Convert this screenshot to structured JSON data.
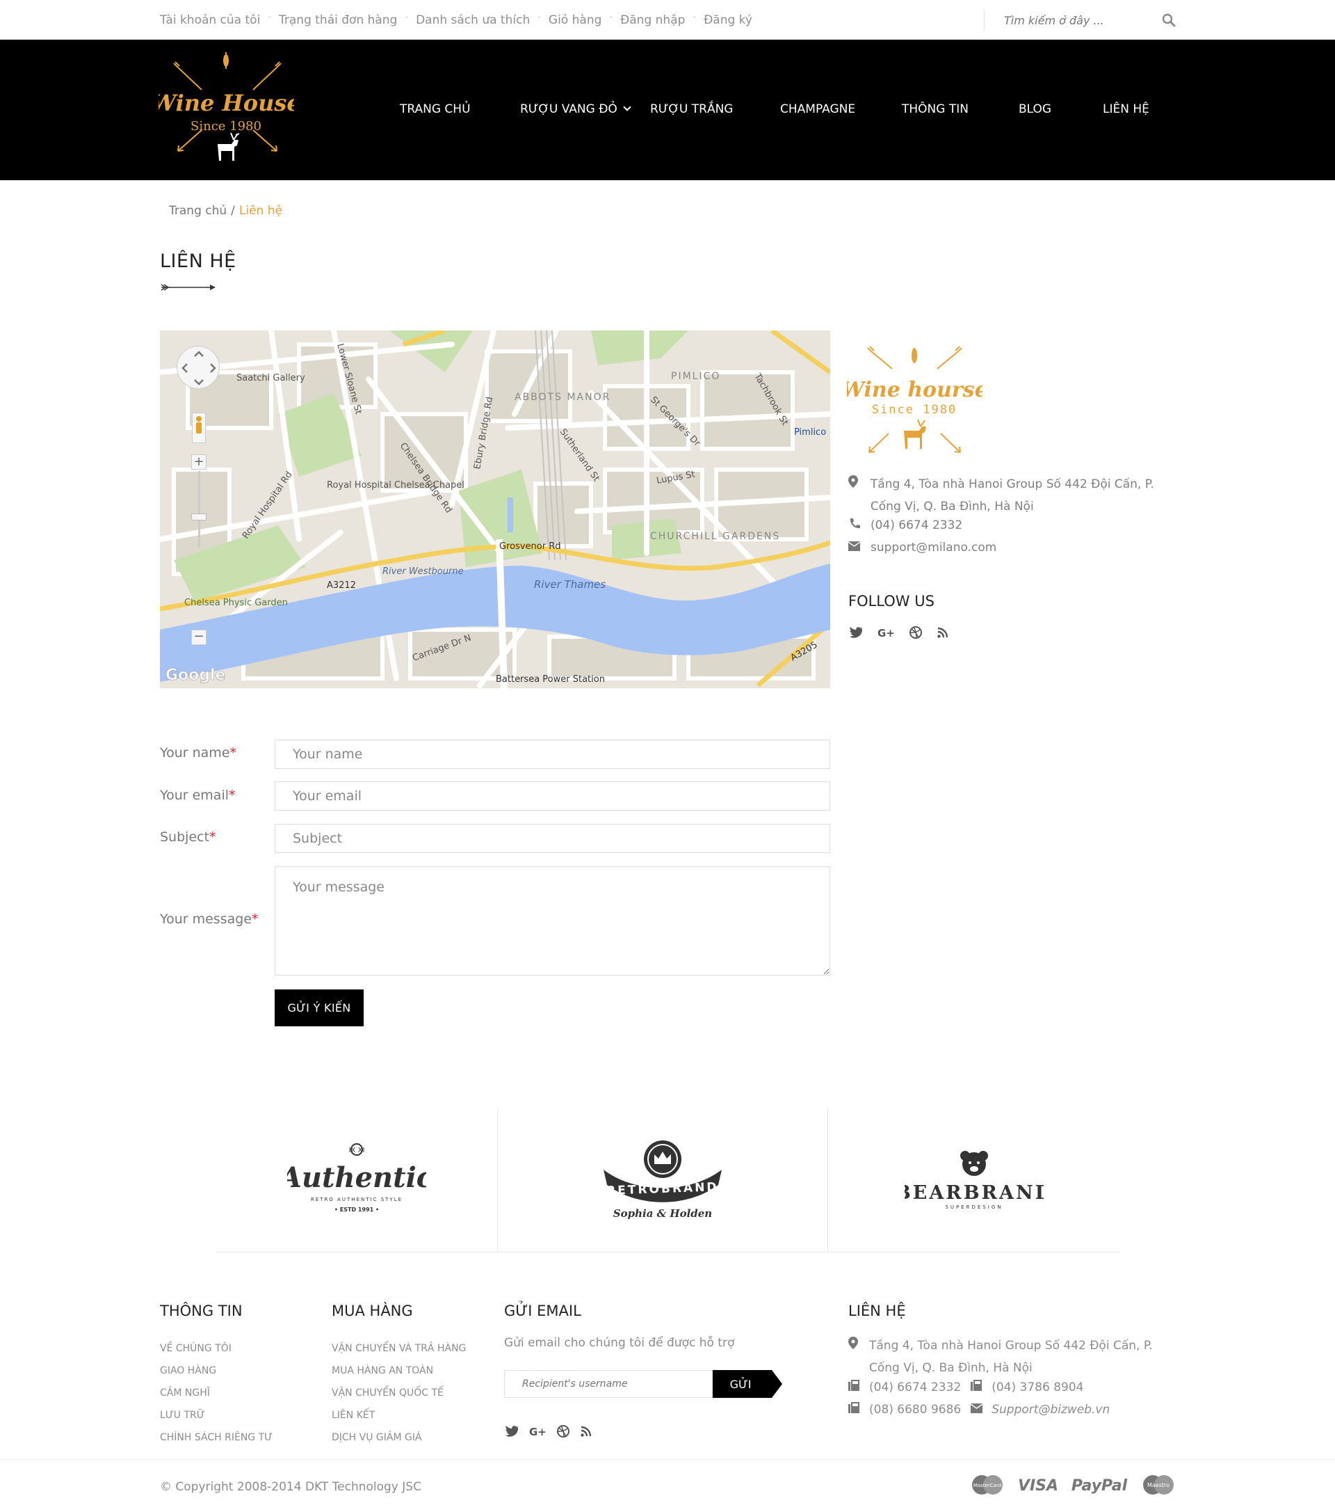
{
  "topbar": {
    "links": [
      "Tài khoản của tôi",
      "Trạng thái đơn hàng",
      "Danh sách ưa thích",
      "Giỏ hàng",
      "Đăng nhập",
      "Đăng ký"
    ],
    "search_placeholder": "Tìm kiếm ở đây ..."
  },
  "logo": {
    "name": "Wine House",
    "since": "Since 1980"
  },
  "nav": [
    "TRANG CHỦ",
    "RƯỢU VANG ĐỎ",
    "RƯỢU TRẮNG",
    "CHAMPAGNE",
    "THÔNG TIN",
    "BLOG",
    "LIÊN HỆ"
  ],
  "breadcrumb": {
    "home": "Trang chủ",
    "current": "Liên hệ"
  },
  "page_title": "LIÊN HỆ",
  "map": {
    "labels": [
      "Saatchi Gallery",
      "Royal Hospital Chelsea Chapel",
      "ABBOTS MANOR",
      "PIMLICO",
      "Pimlico",
      "CHURCHILL GARDENS",
      "Grosvenor Rd",
      "A3212",
      "River Thames",
      "River Westbourne",
      "Chelsea Physic Garden",
      "Battersea Power Station",
      "Chelsea Bridge Rd",
      "Royal Hospital Rd",
      "Sutherland St",
      "Lupus St",
      "Lower Sloane St",
      "Ebury Bridge Rd",
      "St George's Dr",
      "Tachbrook St",
      "A3205",
      "Carriage Dr N",
      "Google"
    ]
  },
  "side_logo": {
    "name": "Wine hourse",
    "since": "Since 1980"
  },
  "contact": {
    "address": "Tầng 4, Tòa nhà Hanoi Group Số 442 Đội Cấn, P. Cống Vị, Q. Ba Đình, Hà Nội",
    "phone": "(04) 6674 2332",
    "email": "support@milano.com"
  },
  "follow_title": "FOLLOW US",
  "form": {
    "name_label": "Your name",
    "name_placeholder": "Your name",
    "email_label": "Your email",
    "email_placeholder": "Your email",
    "subject_label": "Subject",
    "subject_placeholder": "Subject",
    "message_label": "Your message",
    "message_placeholder": "Your message",
    "required_mark": "*",
    "submit": "GỬI Ý KIẾN"
  },
  "brands": [
    {
      "name": "Authentic",
      "top": "IX  XI",
      "tag": "RETRO AUTHENTIC STYLE",
      "est": "• ESTD 1991 •"
    },
    {
      "name": "RETROBRAND",
      "tag": "Sophia & Holden"
    },
    {
      "name": "BEARBRAND",
      "tag": "SUPERDESIGN"
    }
  ],
  "footer": {
    "col1": {
      "title": "THÔNG TIN",
      "items": [
        "Về chúng tôi",
        "Giao hàng",
        "Cảm nghĩ",
        "Lưu trữ",
        "Chính sách riêng tư"
      ]
    },
    "col2": {
      "title": "MUA HÀNG",
      "items": [
        "Vận chuyển và trả hàng",
        "Mua hàng an toàn",
        "Vận chuyển quốc tế",
        "Liên kết",
        "Dịch vụ giảm giá"
      ]
    },
    "col3": {
      "title": "GỬI EMAIL",
      "text": "Gửi email cho chúng tôi để được hỗ trợ",
      "placeholder": "Recipient's username",
      "button": "GỬI"
    },
    "col4": {
      "title": "LIÊN HỆ",
      "address": "Tầng 4, Tòa nhà Hanoi Group Số 442 Đội Cấn, P. Cống Vị, Q. Ba Đình, Hà Nội",
      "phone1": "(04) 6674 2332",
      "phone2": "(04) 3786 8904",
      "phone3": "(08) 6680 9686",
      "email": "Support@bizweb.vn"
    },
    "copyright": "© Copyright 2008-2014 DKT Technology JSC",
    "payments": [
      "MasterCard",
      "VISA",
      "PayPal",
      "Maestro"
    ]
  },
  "colors": {
    "accent": "#e5a23a",
    "header_bg": "#000000",
    "water": "#a4c2f4",
    "park": "#c5dcab",
    "road_major": "#f7d56a"
  }
}
